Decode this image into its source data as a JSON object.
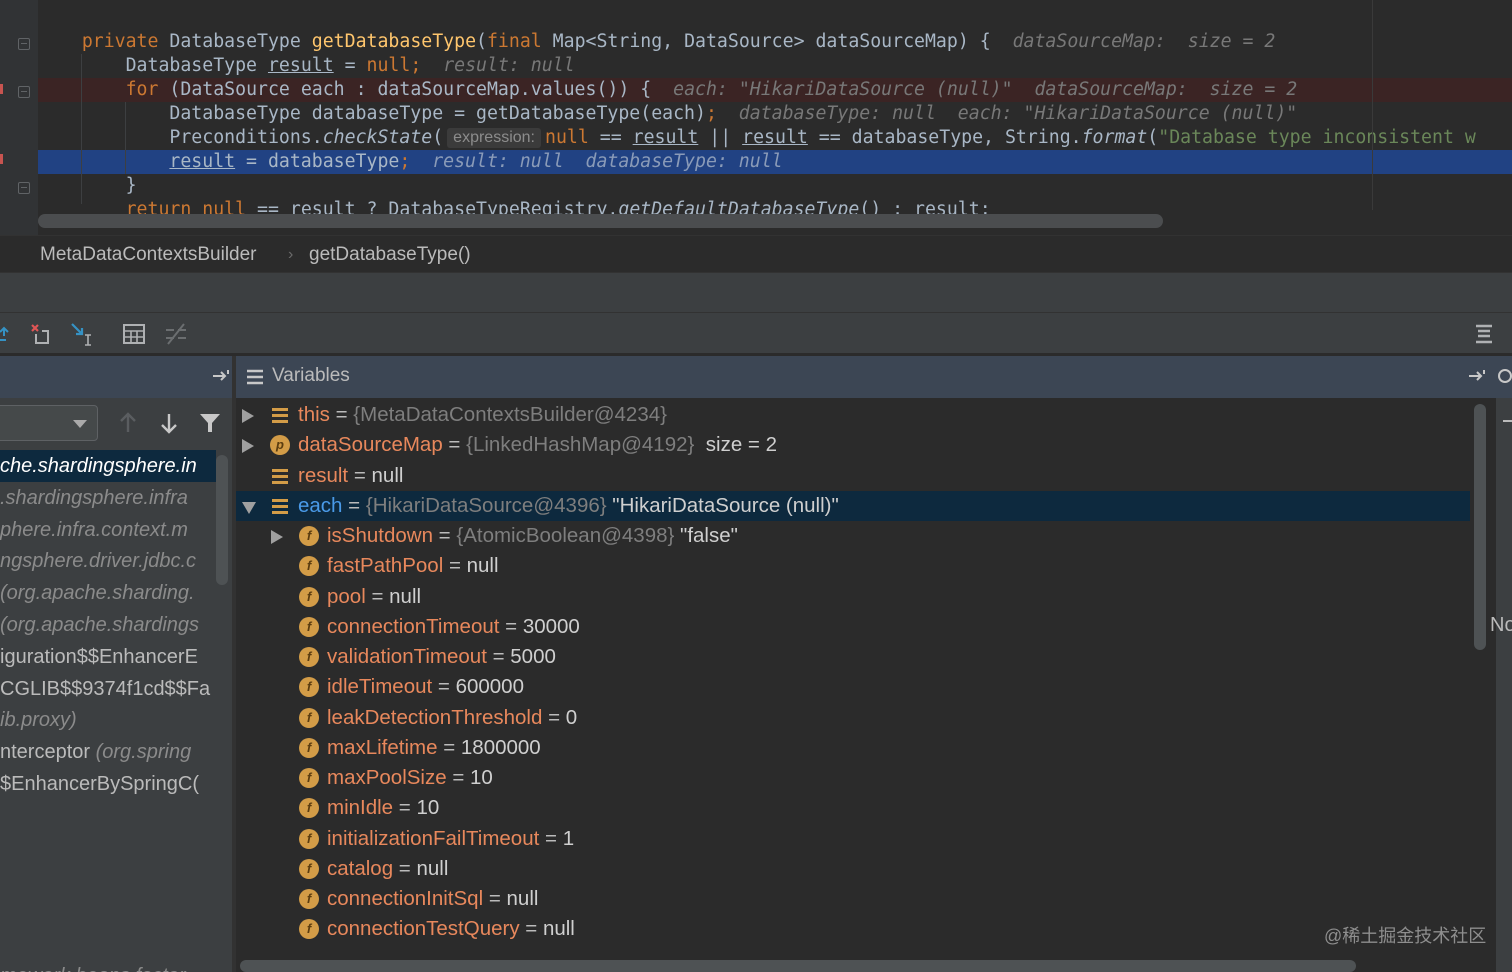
{
  "editor": {
    "line1": {
      "indent": "    ",
      "kw_private": "private",
      "type": " DatabaseType ",
      "fn": "getDatabaseType",
      "paren_open": "(",
      "kw_final": "final",
      "rest": " Map<String, DataSource> dataSourceMap) {",
      "hint": "  dataSourceMap:  size = 2"
    },
    "line2": {
      "indent": "        ",
      "pre": "DatabaseType ",
      "var": "result",
      "mid": " = ",
      "kw_null": "null",
      "semi": ";",
      "hint": "  result: null"
    },
    "line3": {
      "indent": "        ",
      "kw_for": "for",
      "rest": " (DataSource each : dataSourceMap.values()) {",
      "hint": "  each: \"HikariDataSource (null)\"  dataSourceMap:  size = 2"
    },
    "line4": {
      "indent": "            ",
      "pre": "DatabaseType databaseType = getDatabaseType(each)",
      "semi": ";",
      "hint": "  databaseType: null  each: \"HikariDataSource (null)\""
    },
    "line5": {
      "indent": "            ",
      "pre": "Preconditions.",
      "method": "checkState",
      "paren": "(",
      "inlay": "expression:",
      "kw_null": "null",
      "op1": " == ",
      "var1": "result",
      "op2": " || ",
      "var2": "result",
      "op3": " == databaseType, String.",
      "format": "format",
      "paren2": "(",
      "str": "\"Database type inconsistent w"
    },
    "line6": {
      "indent": "            ",
      "var": "result",
      "rest": " = databaseType",
      "semi": ";",
      "hint": "  result: null  databaseType: null"
    },
    "line7": {
      "indent": "        ",
      "brace": "}"
    },
    "line8": {
      "indent": "        ",
      "kw_return": "return",
      "sp1": " ",
      "kw_null": "null",
      "rest": " == result ? DatabaseTypeRegistry.",
      "method": "getDefaultDatabaseType",
      "tail": "() : result;"
    }
  },
  "breadcrumb": {
    "class_name": "MetaDataContextsBuilder",
    "separator": "›",
    "method_name": "getDatabaseType()"
  },
  "toolbar": {
    "icons": [
      "step-out-icon",
      "drop-frame-icon",
      "run-to-cursor-icon",
      "evaluate-expression-icon",
      "trace-icon",
      "settings-list-icon"
    ]
  },
  "frames": {
    "items": [
      {
        "prefix": "",
        "text": "che.shardingsphere.in",
        "selected": true
      },
      {
        "prefix": "",
        "text": ".shardingsphere.infra",
        "selected": false
      },
      {
        "prefix": "",
        "text": "phere.infra.context.m",
        "selected": false
      },
      {
        "prefix": "",
        "text": "ngsphere.driver.jdbc.c",
        "selected": false
      },
      {
        "prefix": "",
        "text": "(org.apache.sharding.",
        "selected": false
      },
      {
        "prefix": "",
        "text": "(org.apache.shardings",
        "selected": false
      },
      {
        "prefix": "iguration$$EnhancerE",
        "text": "",
        "selected": false
      },
      {
        "prefix": "CGLIB$$9374f1cd$$Fa",
        "text": "",
        "selected": false
      },
      {
        "prefix": "",
        "text": "ib.proxy)",
        "selected": false
      },
      {
        "prefix": "nterceptor ",
        "text": "(org.spring",
        "selected": false
      },
      {
        "prefix": "$EnhancerBySpringC(",
        "text": "",
        "selected": false
      },
      {
        "prefix": "",
        "text": "mework.beans.factor",
        "selected": false
      }
    ]
  },
  "variables": {
    "title": "Variables",
    "rows": [
      {
        "name": "this",
        "eq": " = ",
        "type": "{MetaDataContextsBuilder@4234}",
        "value": "",
        "icon": "list",
        "expander": "right",
        "level": 0,
        "selected": false
      },
      {
        "name": "dataSourceMap",
        "eq": " = ",
        "type": "{LinkedHashMap@4192}",
        "value": "  size = 2",
        "icon": "p",
        "expander": "right",
        "level": 0,
        "selected": false
      },
      {
        "name": "result",
        "eq": " = ",
        "type": "",
        "value": "null",
        "icon": "list",
        "expander": "",
        "level": 0,
        "selected": false
      },
      {
        "name": "each",
        "eq": " = ",
        "type": "{HikariDataSource@4396}",
        "value": " \"HikariDataSource (null)\"",
        "icon": "list",
        "expander": "down",
        "level": 0,
        "selected": true
      },
      {
        "name": "isShutdown",
        "eq": " = ",
        "type": "{AtomicBoolean@4398}",
        "value": " \"false\"",
        "icon": "f",
        "expander": "right",
        "level": 1,
        "selected": false
      },
      {
        "name": "fastPathPool",
        "eq": " = ",
        "type": "",
        "value": "null",
        "icon": "f",
        "expander": "",
        "level": 1,
        "selected": false
      },
      {
        "name": "pool",
        "eq": " = ",
        "type": "",
        "value": "null",
        "icon": "f",
        "expander": "",
        "level": 1,
        "selected": false
      },
      {
        "name": "connectionTimeout",
        "eq": " = ",
        "type": "",
        "value": "30000",
        "icon": "f",
        "expander": "",
        "level": 1,
        "selected": false
      },
      {
        "name": "validationTimeout",
        "eq": " = ",
        "type": "",
        "value": "5000",
        "icon": "f",
        "expander": "",
        "level": 1,
        "selected": false
      },
      {
        "name": "idleTimeout",
        "eq": " = ",
        "type": "",
        "value": "600000",
        "icon": "f",
        "expander": "",
        "level": 1,
        "selected": false
      },
      {
        "name": "leakDetectionThreshold",
        "eq": " = ",
        "type": "",
        "value": "0",
        "icon": "f",
        "expander": "",
        "level": 1,
        "selected": false
      },
      {
        "name": "maxLifetime",
        "eq": " = ",
        "type": "",
        "value": "1800000",
        "icon": "f",
        "expander": "",
        "level": 1,
        "selected": false
      },
      {
        "name": "maxPoolSize",
        "eq": " = ",
        "type": "",
        "value": "10",
        "icon": "f",
        "expander": "",
        "level": 1,
        "selected": false
      },
      {
        "name": "minIdle",
        "eq": " = ",
        "type": "",
        "value": "10",
        "icon": "f",
        "expander": "",
        "level": 1,
        "selected": false
      },
      {
        "name": "initializationFailTimeout",
        "eq": " = ",
        "type": "",
        "value": "1",
        "icon": "f",
        "expander": "",
        "level": 1,
        "selected": false
      },
      {
        "name": "catalog",
        "eq": " = ",
        "type": "",
        "value": "null",
        "icon": "f",
        "expander": "",
        "level": 1,
        "selected": false
      },
      {
        "name": "connectionInitSql",
        "eq": " = ",
        "type": "",
        "value": "null",
        "icon": "f",
        "expander": "",
        "level": 1,
        "selected": false
      },
      {
        "name": "connectionTestQuery",
        "eq": " = ",
        "type": "",
        "value": "null",
        "icon": "f",
        "expander": "",
        "level": 1,
        "selected": false
      }
    ]
  },
  "right_edge": {
    "cut_text": "No"
  },
  "watermark": "@稀土掘金技术社区",
  "colors": {
    "editor_bg": "#2b2b2b",
    "panel_bg": "#3c3f41",
    "selection": "#214283",
    "var_selection": "#0d293e",
    "field_name": "#e8885c",
    "keyword": "#cc7832",
    "function": "#ffc66d"
  }
}
